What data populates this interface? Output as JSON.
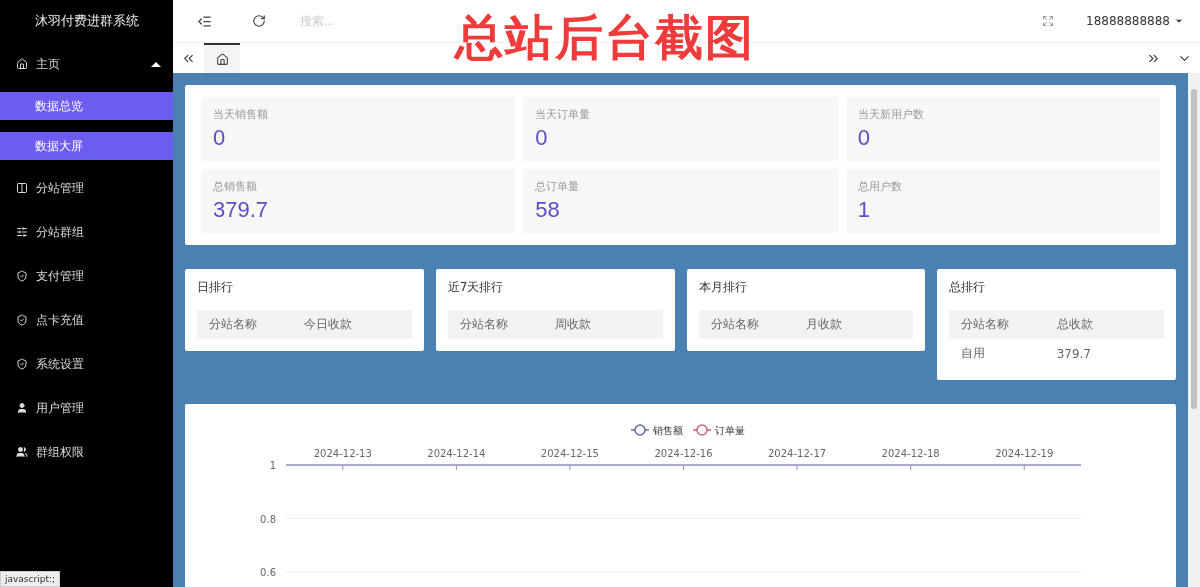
{
  "sidebar": {
    "title": "沐羽付费进群系统",
    "items": [
      {
        "label": "主页",
        "kind": "home",
        "expanded": true,
        "children": [
          {
            "label": "数据总览",
            "selected": true
          },
          {
            "label": "数据大屏",
            "selected": true
          }
        ]
      },
      {
        "label": "分站管理",
        "kind": "columns"
      },
      {
        "label": "分站群组",
        "kind": "sliders"
      },
      {
        "label": "支付管理",
        "kind": "shield"
      },
      {
        "label": "点卡充值",
        "kind": "shield"
      },
      {
        "label": "系统设置",
        "kind": "shield"
      },
      {
        "label": "用户管理",
        "kind": "user"
      },
      {
        "label": "群组权限",
        "kind": "users"
      }
    ]
  },
  "header": {
    "search": {
      "placeholder": "搜索..."
    },
    "user": "18888888888",
    "banner_caption": "总站后台截图"
  },
  "tabs": [
    {
      "kind": "home",
      "selected": true
    }
  ],
  "stats": [
    {
      "label": "当天销售额",
      "value": "0"
    },
    {
      "label": "当天订单量",
      "value": "0"
    },
    {
      "label": "当天新用户数",
      "value": "0"
    },
    {
      "label": "总销售额",
      "value": "379.7"
    },
    {
      "label": "总订单量",
      "value": "58"
    },
    {
      "label": "总用户数",
      "value": "1"
    }
  ],
  "rankings": [
    {
      "title": "日排行",
      "columns": [
        "分站名称",
        "今日收款"
      ]
    },
    {
      "title": "近7天排行",
      "columns": [
        "分站名称",
        "周收款"
      ]
    },
    {
      "title": "本月排行",
      "columns": [
        "分站名称",
        "月收款"
      ]
    },
    {
      "title": "总排行",
      "columns": [
        "分站名称",
        "总收款"
      ],
      "rows": [
        [
          "自用",
          "379.7"
        ]
      ]
    }
  ],
  "chart": {
    "chart_data": {
      "type": "line",
      "categories": [
        "2024-12-13",
        "2024-12-14",
        "2024-12-15",
        "2024-12-16",
        "2024-12-17",
        "2024-12-18",
        "2024-12-19"
      ],
      "series": [
        {
          "name": "销售额",
          "color": "#5b6aa8",
          "values": [
            null,
            null,
            null,
            null,
            null,
            null,
            null
          ]
        },
        {
          "name": "订单量",
          "color": "#d0627a",
          "values": [
            null,
            null,
            null,
            null,
            null,
            null,
            null
          ]
        }
      ],
      "ylim": [
        0.6,
        1
      ],
      "yticks": [
        0.6,
        0.8,
        1
      ]
    }
  },
  "status_bar": "javascript:;"
}
